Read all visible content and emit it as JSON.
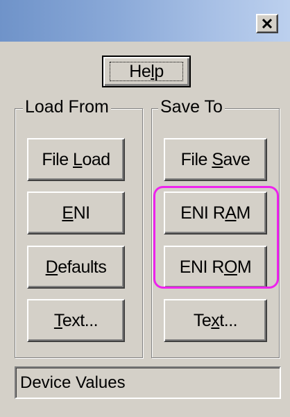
{
  "titlebar": {
    "close_icon": "close-x-icon"
  },
  "help": {
    "label_pre": "He",
    "label_accel": "l",
    "label_post": "p"
  },
  "load_group": {
    "title": "Load From",
    "file_load": {
      "pre": "File ",
      "accel": "L",
      "post": "oad"
    },
    "eni": {
      "pre": "",
      "accel": "E",
      "post": "NI"
    },
    "defaults": {
      "pre": "",
      "accel": "D",
      "post": "efaults"
    },
    "text": {
      "pre": "",
      "accel": "T",
      "post": "ext..."
    }
  },
  "save_group": {
    "title": "Save To",
    "file_save": {
      "pre": "File ",
      "accel": "S",
      "post": "ave"
    },
    "eni_ram": {
      "pre": "ENI R",
      "accel": "A",
      "post": "M"
    },
    "eni_rom": {
      "pre": "ENI R",
      "accel": "O",
      "post": "M"
    },
    "text": {
      "pre": "Te",
      "accel": "x",
      "post": "t..."
    }
  },
  "status": {
    "text": "Device Values"
  },
  "colors": {
    "highlight": "#ee22ee",
    "titlebar": "#8aa9d8",
    "face": "#d4d0c8"
  }
}
